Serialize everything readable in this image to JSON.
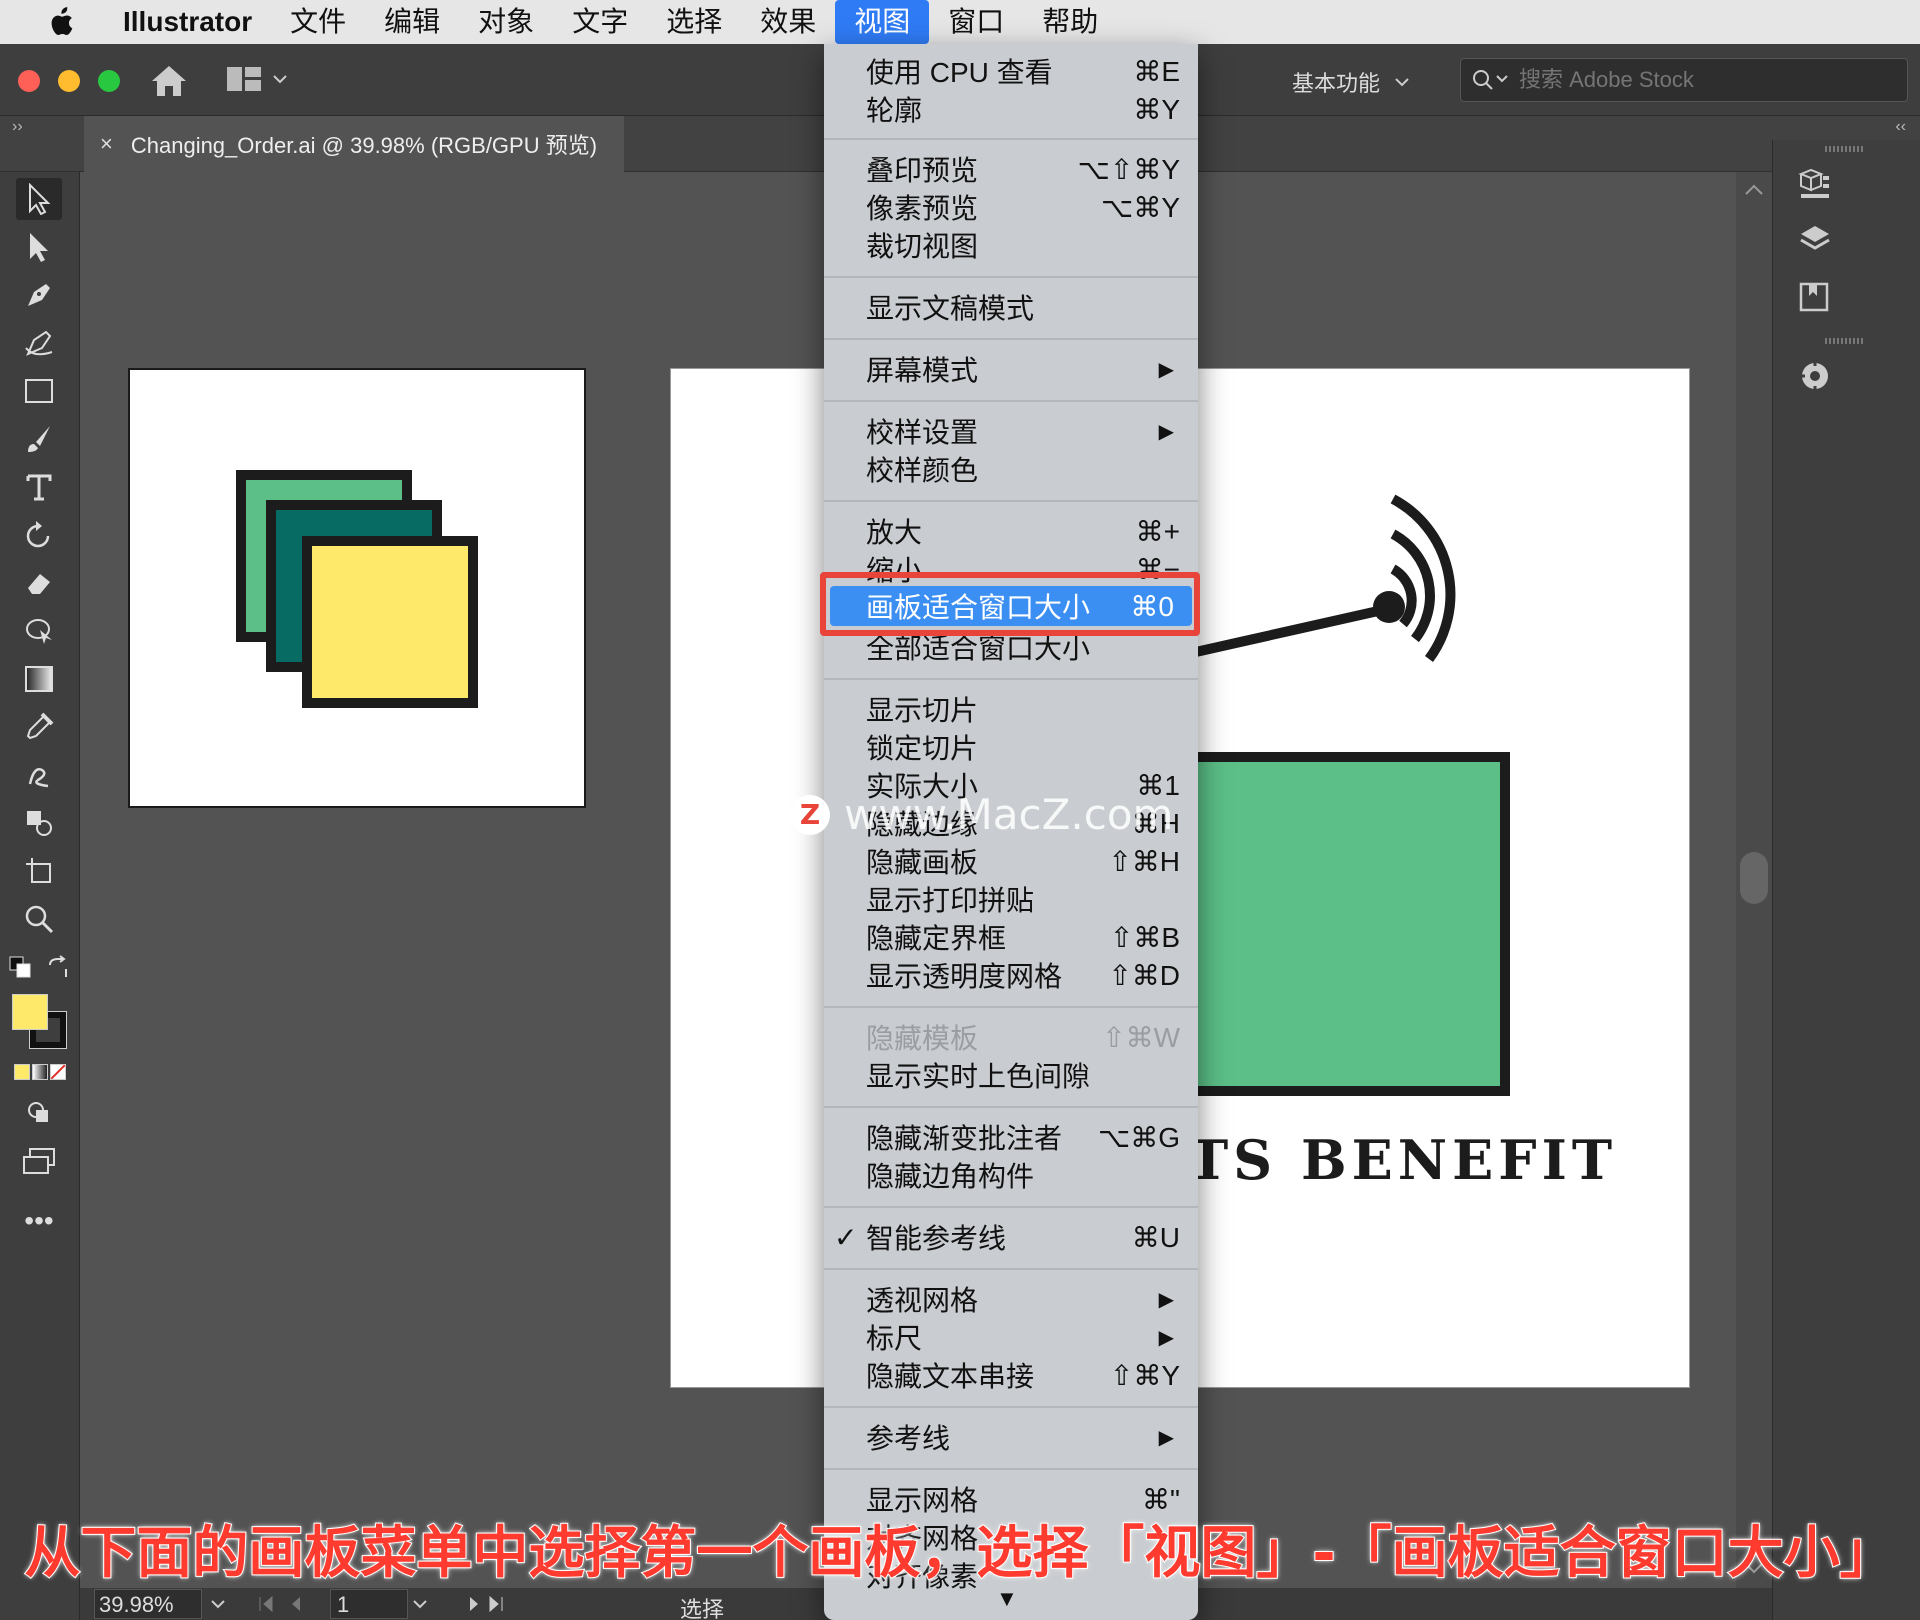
{
  "menubar": {
    "app": "Illustrator",
    "items": [
      "文件",
      "编辑",
      "对象",
      "文字",
      "选择",
      "效果",
      "视图",
      "窗口",
      "帮助"
    ],
    "active": "视图"
  },
  "controlbar": {
    "workspace": "基本功能",
    "search_placeholder": "搜索 Adobe Stock"
  },
  "document": {
    "tab_title": "Changing_Order.ai @ 39.98% (RGB/GPU 预览)",
    "close": "×"
  },
  "artwork": {
    "benefit_text": "TS BENEFIT",
    "colors": {
      "light_green": "#5bbf87",
      "teal": "#076b64",
      "yellow": "#ffe96b",
      "outline": "#1c1c1c"
    }
  },
  "view_menu": {
    "items": [
      {
        "label": "使用 CPU 查看",
        "shortcut": "⌘E"
      },
      {
        "label": "轮廓",
        "shortcut": "⌘Y"
      },
      {
        "label": "叠印预览",
        "shortcut": "⌥⇧⌘Y"
      },
      {
        "label": "像素预览",
        "shortcut": "⌥⌘Y"
      },
      {
        "label": "裁切视图",
        "shortcut": ""
      },
      {
        "label": "显示文稿模式",
        "shortcut": ""
      },
      {
        "label": "屏幕模式",
        "shortcut": "",
        "submenu": true
      },
      {
        "label": "校样设置",
        "shortcut": "",
        "submenu": true
      },
      {
        "label": "校样颜色",
        "shortcut": ""
      },
      {
        "label": "放大",
        "shortcut": "⌘+"
      },
      {
        "label": "缩小",
        "shortcut": "⌘−"
      },
      {
        "label": "画板适合窗口大小",
        "shortcut": "⌘0",
        "highlighted": true
      },
      {
        "label": "全部适合窗口大小",
        "shortcut": ""
      },
      {
        "label": "显示切片",
        "shortcut": ""
      },
      {
        "label": "锁定切片",
        "shortcut": ""
      },
      {
        "label": "实际大小",
        "shortcut": "⌘1"
      },
      {
        "label": "隐藏边缘",
        "shortcut": "⌘H"
      },
      {
        "label": "隐藏画板",
        "shortcut": "⇧⌘H"
      },
      {
        "label": "显示打印拼贴",
        "shortcut": ""
      },
      {
        "label": "隐藏定界框",
        "shortcut": "⇧⌘B"
      },
      {
        "label": "显示透明度网格",
        "shortcut": "⇧⌘D"
      },
      {
        "label": "隐藏模板",
        "shortcut": "⇧⌘W",
        "disabled": true
      },
      {
        "label": "显示实时上色间隙",
        "shortcut": ""
      },
      {
        "label": "隐藏渐变批注者",
        "shortcut": "⌥⌘G"
      },
      {
        "label": "隐藏边角构件",
        "shortcut": ""
      },
      {
        "label": "智能参考线",
        "shortcut": "⌘U",
        "checked": true
      },
      {
        "label": "透视网格",
        "shortcut": "",
        "submenu": true
      },
      {
        "label": "标尺",
        "shortcut": "",
        "submenu": true
      },
      {
        "label": "隐藏文本串接",
        "shortcut": "⇧⌘Y"
      },
      {
        "label": "参考线",
        "shortcut": "",
        "submenu": true
      },
      {
        "label": "显示网格",
        "shortcut": "⌘\""
      },
      {
        "label": "对齐网格",
        "shortcut": ""
      },
      {
        "label": "对齐像素",
        "shortcut": ""
      }
    ],
    "check_mark": "✓",
    "submenu_arrow": "▶",
    "scroll_down": "▼"
  },
  "statusbar": {
    "zoom": "39.98%",
    "page": "1",
    "tool": "选择"
  },
  "watermark": {
    "logo": "Z",
    "text": "www.MacZ.com"
  },
  "caption": "从下面的画板菜单中选择第一个画板，选择「视图」-「画板适合窗口大小」"
}
